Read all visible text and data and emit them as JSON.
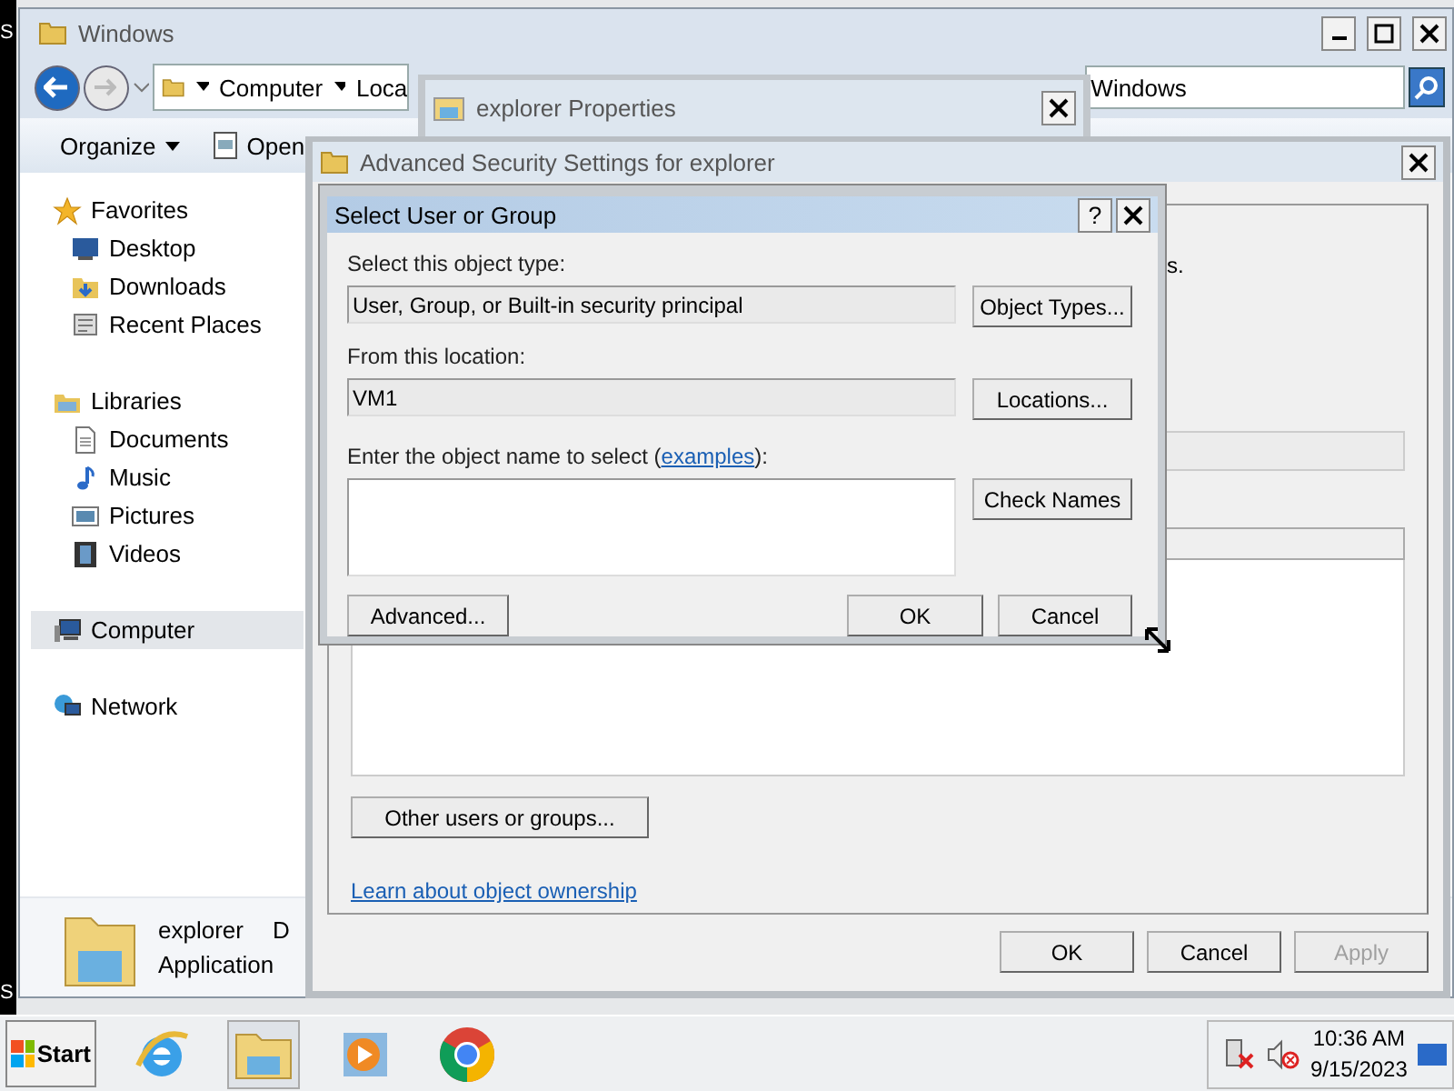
{
  "desktop": {
    "edge_labels": [
      "S",
      "S"
    ]
  },
  "explorer": {
    "title": "Windows",
    "breadcrumb": [
      "Computer",
      "Loca"
    ],
    "search": {
      "value": "Windows"
    },
    "toolbar": [
      "Organize",
      "Open"
    ],
    "sidebar": [
      {
        "label": "Favorites",
        "kind": "star",
        "selected": false,
        "children": [
          {
            "label": "Desktop",
            "kind": "desktop",
            "selected": false
          },
          {
            "label": "Downloads",
            "kind": "downloads",
            "selected": false
          },
          {
            "label": "Recent Places",
            "kind": "recent",
            "selected": false
          }
        ]
      },
      {
        "label": "Libraries",
        "kind": "libraries",
        "selected": false,
        "children": [
          {
            "label": "Documents",
            "kind": "document",
            "selected": false
          },
          {
            "label": "Music",
            "kind": "music",
            "selected": false
          },
          {
            "label": "Pictures",
            "kind": "pictures",
            "selected": false
          },
          {
            "label": "Videos",
            "kind": "videos",
            "selected": false
          }
        ]
      },
      {
        "label": "Computer",
        "kind": "computer",
        "selected": true
      },
      {
        "label": "Network",
        "kind": "network",
        "selected": false
      }
    ],
    "details": {
      "name": "explorer",
      "column_2": "D",
      "type": "Application"
    }
  },
  "properties_window": {
    "title": "explorer Properties"
  },
  "advanced_security": {
    "title": "Advanced Security Settings for explorer",
    "partial_text": "s.",
    "other_button": "Other users or groups...",
    "link": "Learn about object ownership",
    "buttons": [
      {
        "label": "OK",
        "disabled": false
      },
      {
        "label": "Cancel",
        "disabled": false
      },
      {
        "label": "Apply",
        "disabled": true
      }
    ]
  },
  "select_dialog": {
    "title": "Select User or Group",
    "help": "?",
    "object_type_label": "Select this object type:",
    "object_type_value": "User, Group, or Built-in security principal",
    "object_types_button": "Object Types...",
    "location_label": "From this location:",
    "location_value": "VM1",
    "locations_button": "Locations...",
    "name_label": "Enter the object name to select (",
    "examples_link": "examples",
    "name_label_end": "):",
    "check_names_button": "Check Names",
    "advanced_button": "Advanced...",
    "ok_button": "OK",
    "cancel_button": "Cancel"
  },
  "taskbar": {
    "start": "Start",
    "apps": [
      {
        "kind": "browser",
        "selected": false
      },
      {
        "kind": "folder",
        "selected": true
      },
      {
        "kind": "media",
        "selected": false
      },
      {
        "kind": "chrome",
        "selected": false
      }
    ],
    "clock": {
      "time": "10:36 AM",
      "date": "9/15/2023"
    }
  }
}
